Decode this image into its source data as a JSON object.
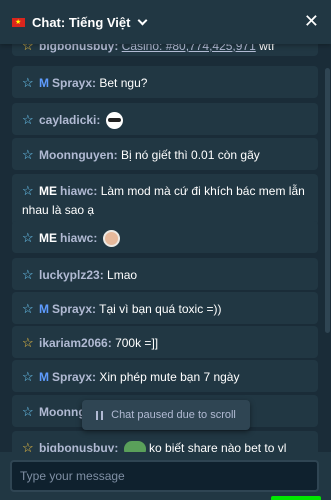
{
  "header": {
    "title": "Chat: Tiếng Việt"
  },
  "messages": [
    {
      "star": "gold",
      "rank": "",
      "user": "bigbonusbuy:",
      "text": "",
      "link": "Casino: #80,774,425,971",
      "suffix": "wtf"
    },
    {
      "star": "cyan",
      "rank": "M",
      "user": "Sprayx:",
      "text": "Bet ngu?"
    },
    {
      "star": "cyan",
      "rank": "",
      "user": "cayladicki:",
      "text": "",
      "emoji": "glasses-emoji"
    },
    {
      "star": "cyan",
      "rank": "",
      "user": "Moonnguyen:",
      "text": "Bị nó giết thì 0.01 còn gãy"
    },
    {
      "star": "cyan",
      "rank": "ME",
      "user": "hiawc:",
      "text": "Làm mod mà cứ đi khích bác mem lẫn nhau là sao ạ"
    },
    {
      "star": "cyan",
      "rank": "ME",
      "user": "hiawc:",
      "text": "",
      "emoji": "face-emoji"
    },
    {
      "star": "cyan",
      "rank": "",
      "user": "luckyplz23:",
      "text": "Lmao"
    },
    {
      "star": "cyan",
      "rank": "M",
      "user": "Sprayx:",
      "text": "Tại vì bạn quá toxic =))"
    },
    {
      "star": "gold",
      "rank": "",
      "user": "ikariam2066:",
      "text": "700k =]]"
    },
    {
      "star": "cyan",
      "rank": "M",
      "user": "Sprayx:",
      "text": "Xin phép mute bạn 7 ngày"
    },
    {
      "star": "cyan",
      "rank": "",
      "user": "Moonngu",
      "text": ""
    },
    {
      "star": "gold",
      "rank": "",
      "user": "bigbonusbuy:",
      "text": "ko biết share nào bet to vl thế, có",
      "emoji": "frog-emoji"
    }
  ],
  "paused_banner": {
    "label": "Chat paused due to scroll"
  },
  "composer": {
    "placeholder": "Type your message"
  },
  "colors": {
    "background": "#1a2c38",
    "panel": "#213743",
    "accent_green": "#00e701",
    "mod_blue": "#5f9cff",
    "gold_star": "#f5c542",
    "cyan_star": "#6fd0ff"
  },
  "icons": {
    "flag": "vietnam-flag-icon",
    "dropdown": "chevron-down-icon",
    "close": "close-icon",
    "pause": "pause-icon",
    "star": "star-icon"
  }
}
